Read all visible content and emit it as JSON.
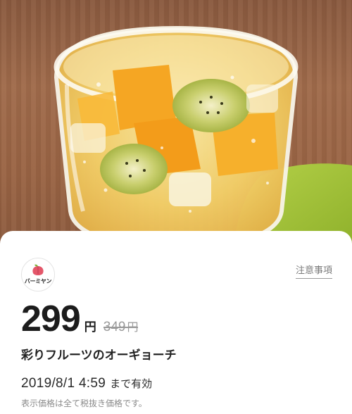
{
  "store": {
    "logo_icon": "peach-icon",
    "brand_text": "バーミヤン"
  },
  "notes_link": "注意事項",
  "price": {
    "current": "299",
    "currency": "円",
    "original": "349",
    "original_currency": "円"
  },
  "product_name": "彩りフルーツのオーギョーチ",
  "validity": {
    "date": "2019/8/1 4:59",
    "suffix": "まで有効"
  },
  "tax_note": "表示価格は全て税抜き価格です。",
  "colors": {
    "accent_peach": "#e4576a",
    "text_primary": "#1c1c1c",
    "text_muted": "#9a9a9a"
  }
}
